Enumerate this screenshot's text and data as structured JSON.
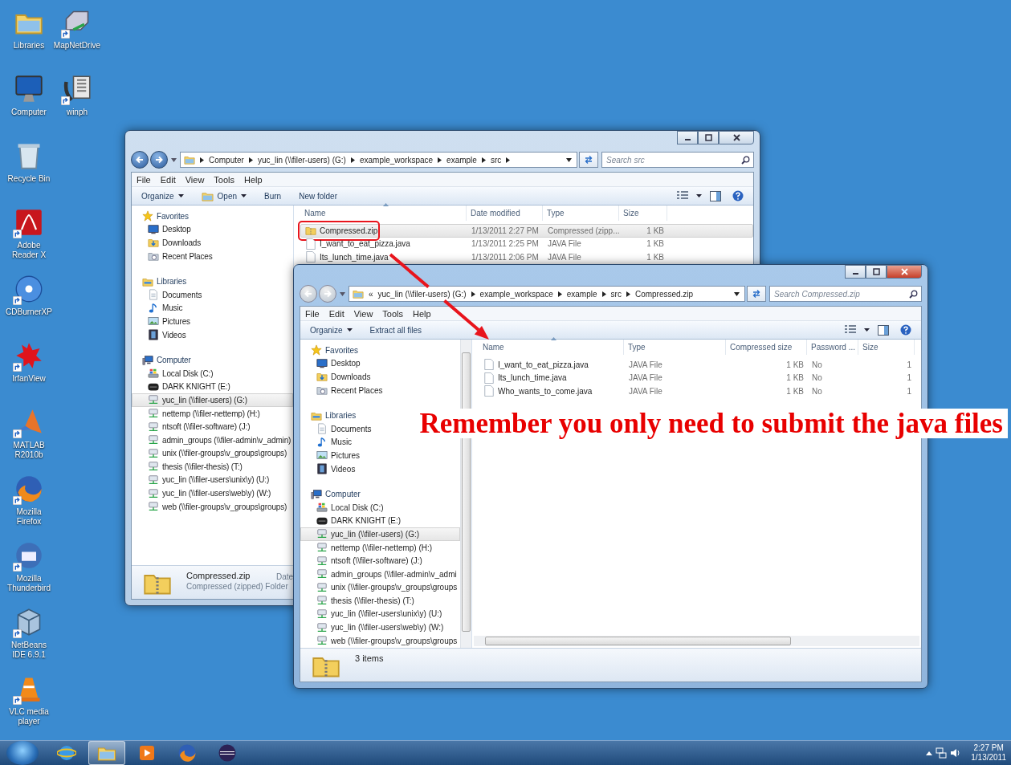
{
  "desktop_icons": [
    {
      "label": "Libraries",
      "kind": "folder",
      "shortcut": false
    },
    {
      "label": "Computer",
      "kind": "monitor",
      "shortcut": false
    },
    {
      "label": "Recycle Bin",
      "kind": "bin",
      "shortcut": false
    },
    {
      "label": "Adobe Reader X",
      "kind": "pdf",
      "shortcut": true
    },
    {
      "label": "CDBurnerXP",
      "kind": "disc",
      "shortcut": true
    },
    {
      "label": "IrfanView",
      "kind": "splat",
      "shortcut": true
    },
    {
      "label": "MATLAB R2010b",
      "kind": "peak",
      "shortcut": true
    },
    {
      "label": "Mozilla Firefox",
      "kind": "foxglobe",
      "shortcut": true
    },
    {
      "label": "Mozilla Thunderbird",
      "kind": "birdglobe",
      "shortcut": true
    },
    {
      "label": "NetBeans IDE 6.9.1",
      "kind": "cube",
      "shortcut": true
    },
    {
      "label": "VLC media player",
      "kind": "cone",
      "shortcut": true
    },
    {
      "label": "MapNetDrive",
      "kind": "netdrive",
      "shortcut": true
    },
    {
      "label": "winph",
      "kind": "phone",
      "shortcut": true
    }
  ],
  "windows": [
    {
      "active": false,
      "address": {
        "segments": [
          "Computer",
          "yuc_lin (\\\\filer-users) (G:)",
          "example_workspace",
          "example",
          "src"
        ],
        "trailing_separator": true
      },
      "search": {
        "placeholder": "Search src"
      },
      "menu": [
        "File",
        "Edit",
        "View",
        "Tools",
        "Help"
      ],
      "toolbar": [
        {
          "label": "Organize",
          "icon": false,
          "dropdown": true
        },
        {
          "label": "Open",
          "icon": true,
          "dropdown": true
        },
        {
          "label": "Burn",
          "icon": false,
          "dropdown": false
        },
        {
          "label": "New folder",
          "icon": false,
          "dropdown": false
        }
      ],
      "nav": [
        {
          "label": "Favorites",
          "kind": "star",
          "selected": false,
          "children": [
            {
              "label": "Desktop",
              "kind": "desktop",
              "selected": false
            },
            {
              "label": "Downloads",
              "kind": "downloads",
              "selected": false
            },
            {
              "label": "Recent Places",
              "kind": "recent",
              "selected": false
            }
          ]
        },
        {
          "label": "Libraries",
          "kind": "library",
          "selected": false,
          "children": [
            {
              "label": "Documents",
              "kind": "document",
              "selected": false
            },
            {
              "label": "Music",
              "kind": "music",
              "selected": false
            },
            {
              "label": "Pictures",
              "kind": "pictures",
              "selected": false
            },
            {
              "label": "Videos",
              "kind": "videos",
              "selected": false
            }
          ]
        },
        {
          "label": "Computer",
          "kind": "computer",
          "selected": false,
          "children": [
            {
              "label": "Local Disk (C:)",
              "kind": "disk",
              "selected": false
            },
            {
              "label": "DARK KNIGHT (E:)",
              "kind": "drive",
              "selected": false
            },
            {
              "label": "yuc_lin (\\\\filer-users) (G:)",
              "kind": "network",
              "selected": true
            },
            {
              "label": "nettemp (\\\\filer-nettemp) (H:)",
              "kind": "network",
              "selected": false
            },
            {
              "label": "ntsoft (\\\\filer-software) (J:)",
              "kind": "network",
              "selected": false
            },
            {
              "label": "admin_groups (\\\\filer-admin\\v_admin)",
              "kind": "network",
              "selected": false
            },
            {
              "label": "unix (\\\\filer-groups\\v_groups\\groups)",
              "kind": "network",
              "selected": false
            },
            {
              "label": "thesis (\\\\filer-thesis) (T:)",
              "kind": "network",
              "selected": false
            },
            {
              "label": "yuc_lin (\\\\filer-users\\unix\\y) (U:)",
              "kind": "network",
              "selected": false
            },
            {
              "label": "yuc_lin (\\\\filer-users\\web\\y) (W:)",
              "kind": "network",
              "selected": false
            },
            {
              "label": "web (\\\\filer-groups\\v_groups\\groups)",
              "kind": "network",
              "selected": false
            }
          ]
        }
      ],
      "columns": [
        {
          "label": "Name",
          "sorted": true
        },
        {
          "label": "Date modified",
          "sorted": false
        },
        {
          "label": "Type",
          "sorted": false
        },
        {
          "label": "Size",
          "sorted": false
        }
      ],
      "rows": [
        {
          "kind": "zip",
          "selected": true,
          "circled": true,
          "cells": [
            "Compressed.zip",
            "1/13/2011 2:27 PM",
            "Compressed (zipp...",
            "1 KB"
          ]
        },
        {
          "kind": "java",
          "selected": false,
          "circled": false,
          "cells": [
            "I_want_to_eat_pizza.java",
            "1/13/2011 2:25 PM",
            "JAVA File",
            "1 KB"
          ]
        },
        {
          "kind": "java",
          "selected": false,
          "circled": false,
          "cells": [
            "Its_lunch_time.java",
            "1/13/2011 2:06 PM",
            "JAVA File",
            "1 KB"
          ]
        }
      ],
      "details": {
        "title": "Compressed.zip",
        "subtitle": "Compressed (zipped) Folder",
        "extra": "Date"
      }
    },
    {
      "active": true,
      "address": {
        "leading": "«",
        "segments": [
          "yuc_lin (\\\\filer-users) (G:)",
          "example_workspace",
          "example",
          "src",
          "Compressed.zip"
        ],
        "trailing_separator": false
      },
      "search": {
        "placeholder": "Search Compressed.zip"
      },
      "menu": [
        "File",
        "Edit",
        "View",
        "Tools",
        "Help"
      ],
      "toolbar": [
        {
          "label": "Organize",
          "icon": false,
          "dropdown": true
        },
        {
          "label": "Extract all files",
          "icon": false,
          "dropdown": false
        }
      ],
      "nav": [
        {
          "label": "Favorites",
          "kind": "star",
          "selected": false,
          "children": [
            {
              "label": "Desktop",
              "kind": "desktop",
              "selected": false
            },
            {
              "label": "Downloads",
              "kind": "downloads",
              "selected": false
            },
            {
              "label": "Recent Places",
              "kind": "recent",
              "selected": false
            }
          ]
        },
        {
          "label": "Libraries",
          "kind": "library",
          "selected": false,
          "children": [
            {
              "label": "Documents",
              "kind": "document",
              "selected": false
            },
            {
              "label": "Music",
              "kind": "music",
              "selected": false
            },
            {
              "label": "Pictures",
              "kind": "pictures",
              "selected": false
            },
            {
              "label": "Videos",
              "kind": "videos",
              "selected": false
            }
          ]
        },
        {
          "label": "Computer",
          "kind": "computer",
          "selected": false,
          "children": [
            {
              "label": "Local Disk (C:)",
              "kind": "disk",
              "selected": false
            },
            {
              "label": "DARK KNIGHT (E:)",
              "kind": "drive",
              "selected": false
            },
            {
              "label": "yuc_lin (\\\\filer-users) (G:)",
              "kind": "network",
              "selected": true
            },
            {
              "label": "nettemp (\\\\filer-nettemp) (H:)",
              "kind": "network",
              "selected": false
            },
            {
              "label": "ntsoft (\\\\filer-software) (J:)",
              "kind": "network",
              "selected": false
            },
            {
              "label": "admin_groups (\\\\filer-admin\\v_admi",
              "kind": "network",
              "selected": false
            },
            {
              "label": "unix (\\\\filer-groups\\v_groups\\groups",
              "kind": "network",
              "selected": false
            },
            {
              "label": "thesis (\\\\filer-thesis) (T:)",
              "kind": "network",
              "selected": false
            },
            {
              "label": "yuc_lin (\\\\filer-users\\unix\\y) (U:)",
              "kind": "network",
              "selected": false
            },
            {
              "label": "yuc_lin (\\\\filer-users\\web\\y) (W:)",
              "kind": "network",
              "selected": false
            },
            {
              "label": "web (\\\\filer-groups\\v_groups\\groups",
              "kind": "network",
              "selected": false
            }
          ]
        }
      ],
      "columns": [
        {
          "label": "Name",
          "sorted": true
        },
        {
          "label": "Type",
          "sorted": false
        },
        {
          "label": "Compressed size",
          "sorted": false
        },
        {
          "label": "Password ...",
          "sorted": false
        },
        {
          "label": "Size",
          "sorted": false
        }
      ],
      "rows": [
        {
          "kind": "java",
          "selected": false,
          "circled": false,
          "cells": [
            "I_want_to_eat_pizza.java",
            "JAVA File",
            "1 KB",
            "No",
            "1"
          ]
        },
        {
          "kind": "java",
          "selected": false,
          "circled": false,
          "cells": [
            "Its_lunch_time.java",
            "JAVA File",
            "1 KB",
            "No",
            "1"
          ]
        },
        {
          "kind": "java",
          "selected": false,
          "circled": false,
          "cells": [
            "Who_wants_to_come.java",
            "JAVA File",
            "1 KB",
            "No",
            "1"
          ]
        }
      ],
      "details": {
        "title": "3 items"
      }
    }
  ],
  "annotation": {
    "text": "Remember you only need to submit the java files"
  },
  "taskbar": {
    "buttons": [
      {
        "kind": "ie",
        "active": false
      },
      {
        "kind": "explorer",
        "active": true
      },
      {
        "kind": "media",
        "active": false
      },
      {
        "kind": "firefox",
        "active": false
      },
      {
        "kind": "eclipse",
        "active": false
      }
    ],
    "time": "2:27 PM",
    "date": "1/13/2011"
  }
}
